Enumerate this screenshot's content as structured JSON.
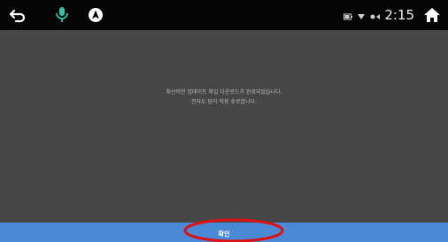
{
  "status_bar": {
    "left_icons": [
      "back-arrow-icon",
      "microphone-icon",
      "navigation-icon"
    ],
    "right_icons": [
      "battery-icon",
      "signal-icon",
      "wifi-icon"
    ],
    "time": "2:15",
    "home_icon": "home-icon"
  },
  "dialog": {
    "message_line1": "최신버전 업데이트 파일 다운로드가 완료되었습니다.",
    "message_line2": "전자도 담아 적용 숏로합니다."
  },
  "confirm_button": {
    "label": "확인"
  },
  "colors": {
    "status_bar_bg": "#050505",
    "content_bg": "#464646",
    "confirm_bg": "#4a89d6",
    "mic_accent": "#30c4a4",
    "annotation_red": "#e01010"
  }
}
